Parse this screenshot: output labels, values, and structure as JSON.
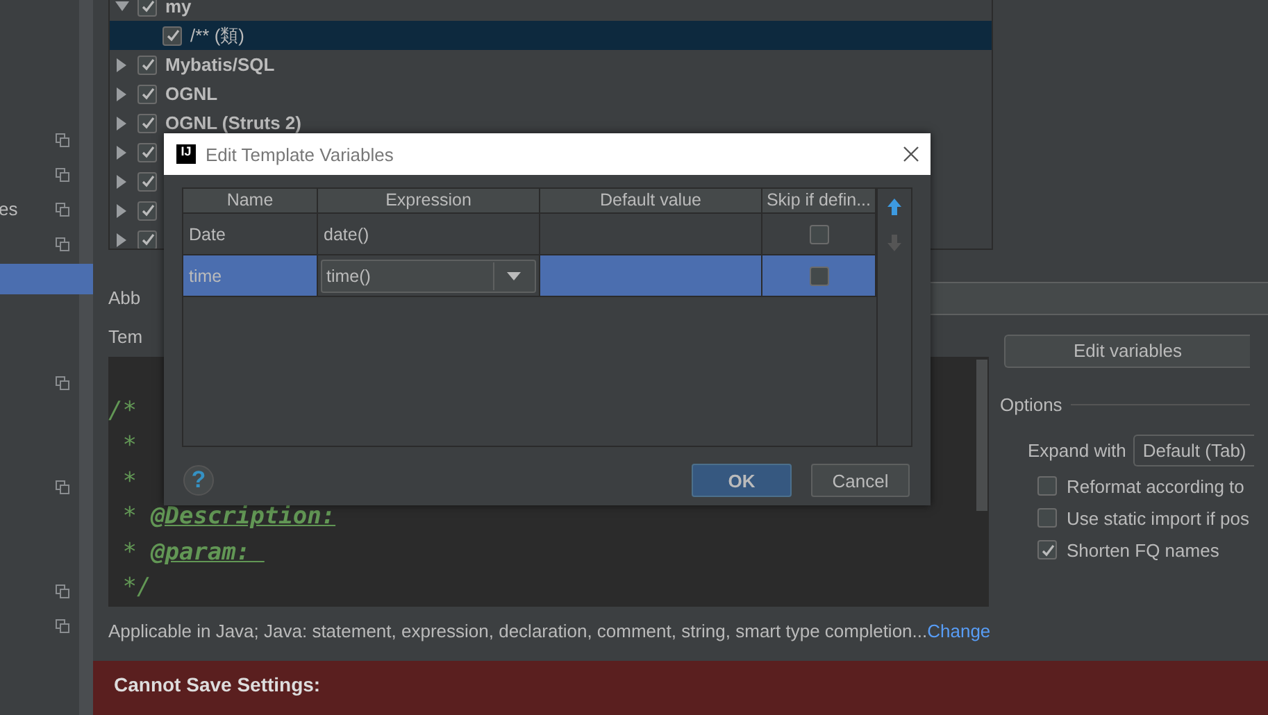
{
  "sidebar": {
    "items": [
      {
        "copy_icon": true,
        "selected": false
      },
      {
        "copy_icon": true,
        "selected": false
      },
      {
        "label": "es",
        "copy_icon": true,
        "selected": false
      },
      {
        "copy_icon": true,
        "selected": false
      },
      {
        "copy_icon": false,
        "selected": true
      },
      {
        "copy_icon": false,
        "selected": false
      },
      {
        "copy_icon": false,
        "selected": false
      },
      {
        "copy_icon": true,
        "selected": false
      },
      {
        "copy_icon": false,
        "selected": false
      },
      {
        "copy_icon": false,
        "selected": false
      },
      {
        "copy_icon": true,
        "selected": false
      },
      {
        "copy_icon": false,
        "selected": false
      },
      {
        "copy_icon": false,
        "selected": false
      },
      {
        "copy_icon": true,
        "selected": false
      },
      {
        "copy_icon": true,
        "selected": false
      }
    ]
  },
  "template_tree": {
    "groups": [
      {
        "label": "my",
        "checked": true,
        "expanded": true,
        "selected": false,
        "children": [
          {
            "label": "/** (類)",
            "checked": true,
            "selected": true
          }
        ]
      },
      {
        "label": "Mybatis/SQL",
        "checked": true,
        "expanded": false,
        "selected": false
      },
      {
        "label": "OGNL",
        "checked": true,
        "expanded": false,
        "selected": false
      },
      {
        "label": "OGNL (Struts 2)",
        "checked": true,
        "expanded": false,
        "selected": false
      },
      {
        "checked": true,
        "expanded": false,
        "selected": false
      },
      {
        "checked": true,
        "expanded": false,
        "selected": false
      },
      {
        "checked": true,
        "expanded": false,
        "selected": false
      },
      {
        "checked": true,
        "expanded": false,
        "selected": false
      }
    ]
  },
  "abbreviation": {
    "label": "Abb"
  },
  "template_text": {
    "label": "Tem",
    "lines": [
      {
        "mark": "/*"
      },
      {
        "mark": " *"
      },
      {
        "mark": " *"
      },
      {
        "mark": " *",
        "tag": "@Description:"
      },
      {
        "mark": " *",
        "tag": "@param: "
      },
      {
        "mark": " */"
      }
    ]
  },
  "edit_variables_button": "Edit variables",
  "options": {
    "title": "Options",
    "expand_with": {
      "label": "Expand with",
      "value": "Default (Tab)"
    },
    "checkboxes": [
      {
        "label": "Reformat according to",
        "checked": false
      },
      {
        "label": "Use static import if pos",
        "checked": false
      },
      {
        "label": "Shorten FQ names",
        "checked": true
      }
    ]
  },
  "applicable": {
    "text": "Applicable in Java; Java: statement, expression, declaration, comment, string, smart type completion...",
    "link": "Change"
  },
  "error_bar": {
    "text": "Cannot Save Settings:"
  },
  "dialog": {
    "app_icon": "IJ",
    "title": "Edit Template Variables",
    "columns": [
      "Name",
      "Expression",
      "Default value",
      "Skip if defin..."
    ],
    "rows": [
      {
        "name": "Date",
        "expression": "date()",
        "skip_if_defined": false,
        "selected": false,
        "editing": false
      },
      {
        "name": "time",
        "expression": "time()",
        "skip_if_defined": false,
        "selected": true,
        "editing": true
      }
    ],
    "move_up": {
      "disabled": false
    },
    "move_down": {
      "disabled": true
    },
    "help": "?",
    "buttons": [
      {
        "label": "OK",
        "default": true
      },
      {
        "label": "Cancel",
        "default": false
      }
    ]
  }
}
